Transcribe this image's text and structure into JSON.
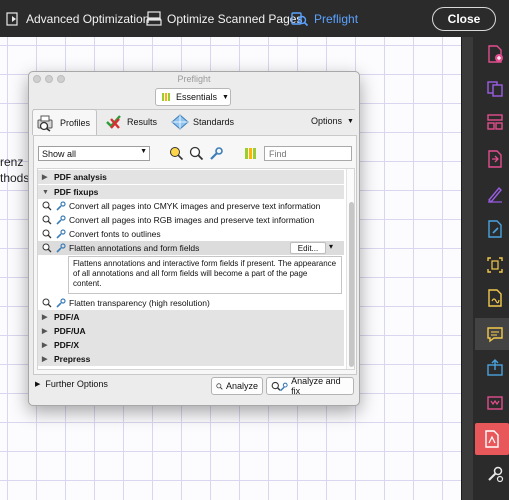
{
  "toolbar": {
    "advanced_optimization": "Advanced Optimization",
    "optimize_scanned_pages": "Optimize Scanned Pages",
    "preflight": "Preflight",
    "close": "Close",
    "active_color": "#5aa2ff"
  },
  "document": {
    "line1": "renz",
    "line2": "thods"
  },
  "dialog": {
    "title": "Preflight",
    "library": "Essentials",
    "tabs": [
      "Profiles",
      "Results",
      "Standards"
    ],
    "options": "Options",
    "filter": "Show all",
    "find_placeholder": "Find",
    "groups": {
      "pdf_analysis": "PDF analysis",
      "pdf_fixups": "PDF fixups",
      "pdfa": "PDF/A",
      "pdfua": "PDF/UA",
      "pdfx": "PDF/X",
      "prepress": "Prepress"
    },
    "fixups": [
      "Convert all pages into CMYK images and preserve text information",
      "Convert all pages into RGB images and preserve text information",
      "Convert fonts to outlines",
      "Flatten annotations and form fields",
      "Flatten transparency (high resolution)"
    ],
    "edit": "Edit...",
    "description": "Flattens annotations and interactive form fields if present. The appearance of all annotations and all form fields will become a part of the page content.",
    "further_options": "Further Options",
    "analyze": "Analyze",
    "analyze_and_fix": "Analyze and fix"
  },
  "rail": {
    "icons": [
      "create-pdf-icon",
      "combine-files-icon",
      "organize-pages-icon",
      "export-pdf-icon",
      "fill-sign-icon",
      "edit-pdf-icon",
      "scan-ocr-icon",
      "request-signature-icon",
      "comment-icon",
      "share-icon",
      "print-production-icon",
      "pdf-standards-icon",
      "more-tools-icon"
    ],
    "colors": {
      "pink": "#e24e8f",
      "purple": "#9b5de5",
      "blue": "#4aa3df",
      "yellow": "#f2c94c",
      "red": "#e8585b"
    }
  }
}
